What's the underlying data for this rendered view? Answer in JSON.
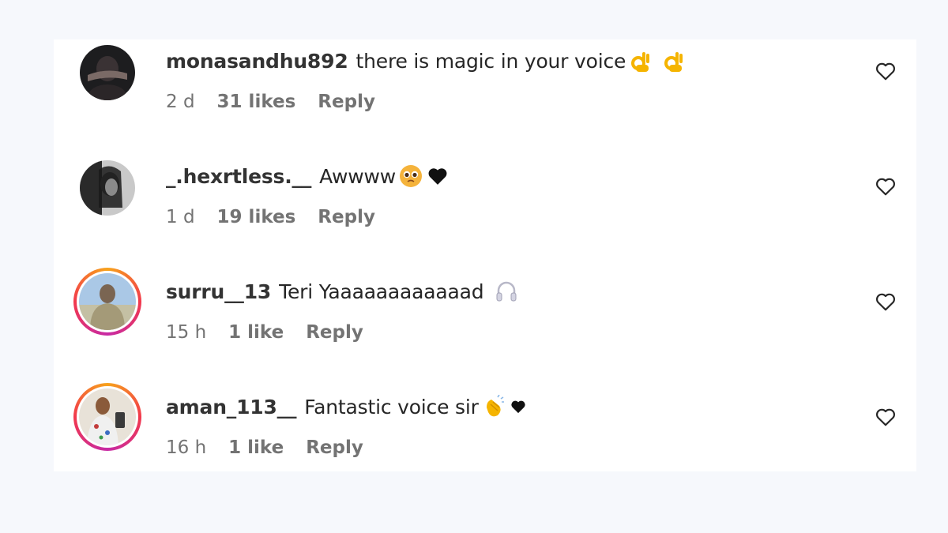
{
  "comments": [
    {
      "username": "monasandhu892",
      "text": "there is magic in your voice",
      "emojis": [
        "ok-hand-emoji",
        "ok-hand-emoji"
      ],
      "age": "2 d",
      "likes": "31 likes",
      "reply": "Reply",
      "has_story": false
    },
    {
      "username": "_.hexrtless.__",
      "text": "Awwww",
      "emojis": [
        "pleading-face-emoji",
        "black-heart-emoji"
      ],
      "age": "1 d",
      "likes": "19 likes",
      "reply": "Reply",
      "has_story": false
    },
    {
      "username": "surru__13",
      "text": "Teri Yaaaaaaaaaaaad",
      "emojis": [
        "headphones-emoji"
      ],
      "age": "15 h",
      "likes": "1 like",
      "reply": "Reply",
      "has_story": true
    },
    {
      "username": "aman_113__",
      "text": "Fantastic voice sir",
      "emojis": [
        "clapping-hands-emoji",
        "black-heart-emoji"
      ],
      "age": "16 h",
      "likes": "1 like",
      "reply": "Reply",
      "has_story": true
    }
  ],
  "colors": {
    "page_background": "#f6f8fc",
    "panel_background": "#ffffff",
    "username": "#333333",
    "meta_text": "#737373",
    "story_ring": [
      "#f7a21b",
      "#f2384c",
      "#c72aa5"
    ]
  },
  "icons": {
    "like": "heart-outline-icon"
  }
}
